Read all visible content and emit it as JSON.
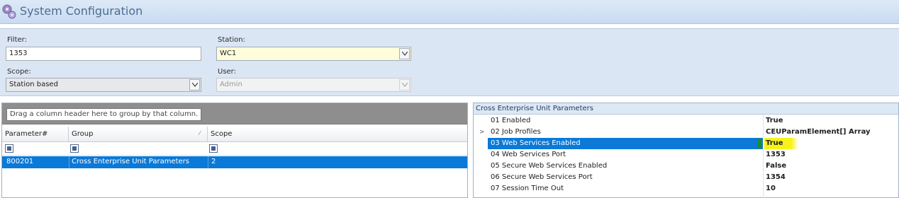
{
  "window": {
    "title": "System Configuration",
    "icon": "gear-icon"
  },
  "filters": {
    "filter_label": "Filter:",
    "filter_value": "1353",
    "station_label": "Station:",
    "station_value": "WC1",
    "scope_label": "Scope:",
    "scope_value": "Station based",
    "user_label": "User:",
    "user_value": "Admin"
  },
  "grid": {
    "group_hint": "Drag a column header here to group by that column.",
    "columns": [
      "Parameter#",
      "Group",
      "Scope"
    ],
    "rows": [
      {
        "parameter": "800201",
        "group": "Cross Enterprise Unit Parameters",
        "scope": "2"
      }
    ]
  },
  "properties": {
    "title": "Cross Enterprise Unit Parameters",
    "rows": [
      {
        "name": "01 Enabled",
        "value": "True"
      },
      {
        "name": "02 Job Profiles",
        "value": "CEUParamElement[] Array"
      },
      {
        "name": "03 Web Services Enabled",
        "value": "True"
      },
      {
        "name": "04 Web Services Port",
        "value": "1353"
      },
      {
        "name": "05 Secure Web Services Enabled",
        "value": "False"
      },
      {
        "name": "06 Secure Web Services Port",
        "value": "1354"
      },
      {
        "name": "07 Session Time Out",
        "value": "10"
      }
    ]
  },
  "colors": {
    "selection": "#0a79d8",
    "highlight": "#f6f21b",
    "title_text": "#4d6d91"
  }
}
